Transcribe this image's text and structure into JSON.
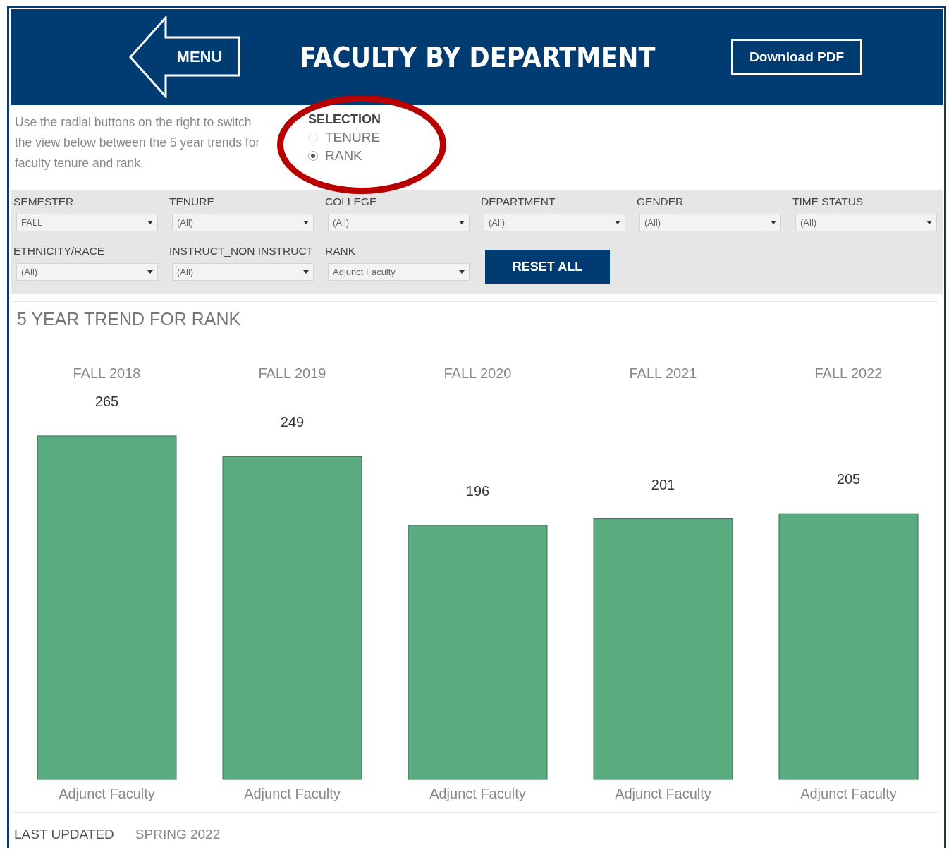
{
  "header": {
    "menu_label": "MENU",
    "title": "FACULTY BY DEPARTMENT",
    "download_label": "Download PDF"
  },
  "intro": {
    "text": "Use the radial buttons on the right to switch the view below between the 5 year trends for faculty tenure and rank."
  },
  "selection": {
    "title": "SELECTION",
    "options": [
      {
        "label": "TENURE",
        "selected": false
      },
      {
        "label": "RANK",
        "selected": true
      }
    ]
  },
  "filters": [
    {
      "label": "SEMESTER",
      "value": "FALL"
    },
    {
      "label": "TENURE",
      "value": "(All)"
    },
    {
      "label": "COLLEGE",
      "value": "(All)"
    },
    {
      "label": "DEPARTMENT",
      "value": "(All)"
    },
    {
      "label": "GENDER",
      "value": "(All)"
    },
    {
      "label": "TIME STATUS",
      "value": "(All)"
    },
    {
      "label": "ETHNICITY/RACE",
      "value": "(All)"
    },
    {
      "label": "INSTRUCT_NON INSTRUCT",
      "value": "(All)"
    },
    {
      "label": "RANK",
      "value": "Adjunct Faculty"
    }
  ],
  "reset_label": "RESET ALL",
  "chart": {
    "title": "5 YEAR TREND FOR RANK",
    "chart_data": {
      "type": "bar",
      "categories": [
        "FALL 2018",
        "FALL 2019",
        "FALL 2020",
        "FALL 2021",
        "FALL 2022"
      ],
      "series": [
        {
          "name": "Adjunct Faculty",
          "color": "#5aab80",
          "values": [
            265,
            249,
            196,
            201,
            205
          ]
        }
      ],
      "value_labels": [
        "265",
        "249",
        "196",
        "201",
        "205"
      ],
      "data_labels": true
    }
  },
  "footer": {
    "label": "LAST UPDATED",
    "value": "SPRING 2022"
  }
}
